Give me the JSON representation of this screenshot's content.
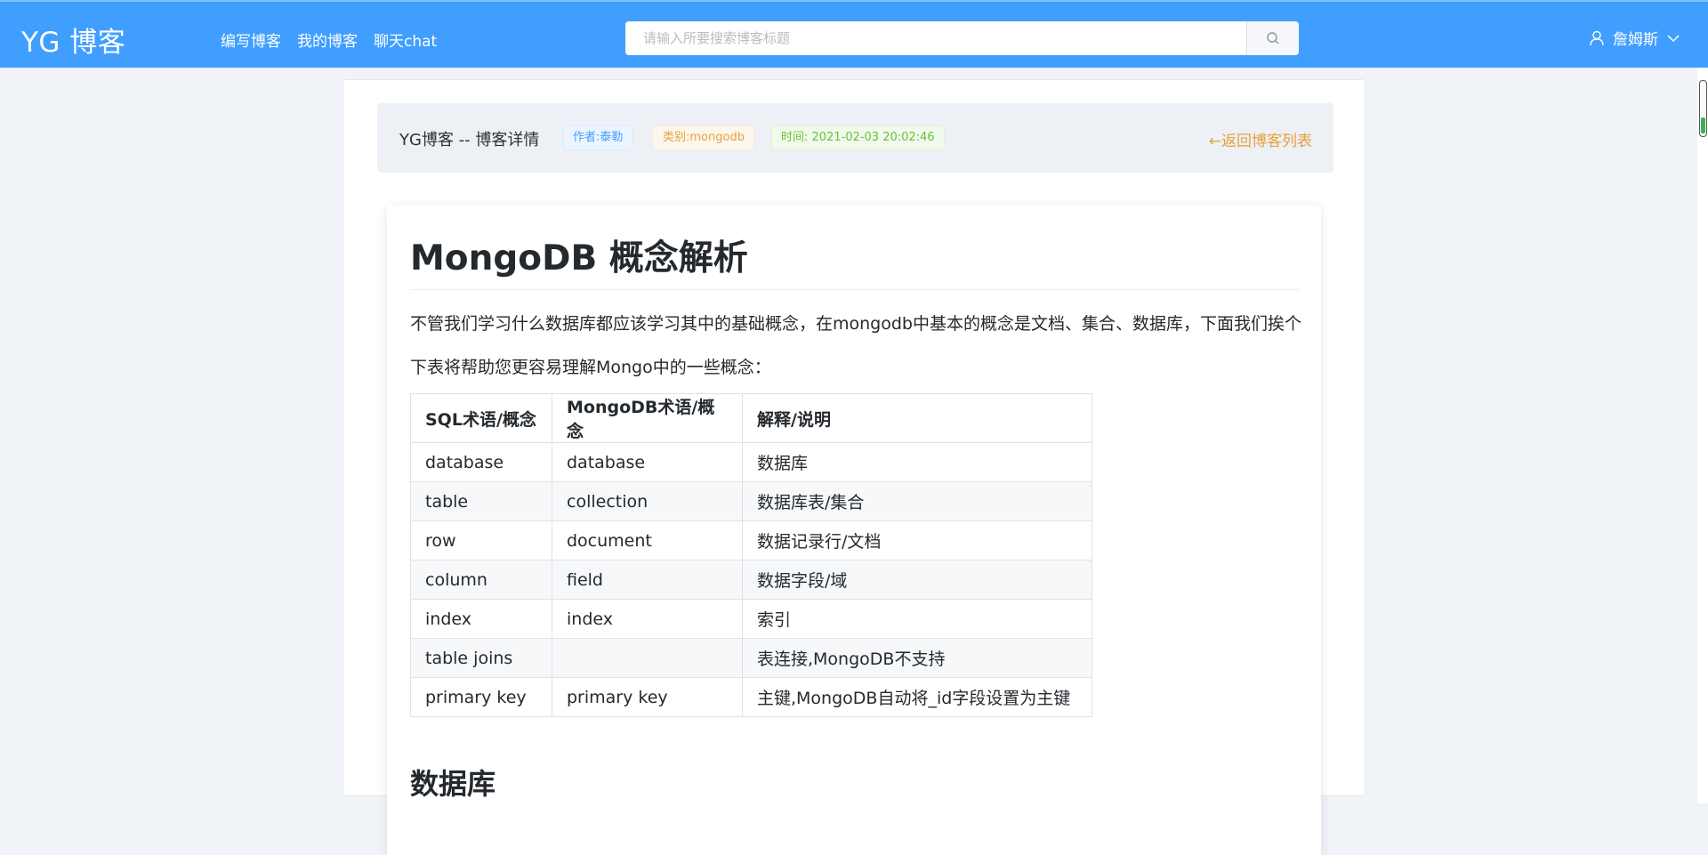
{
  "navbar": {
    "logo": "YG 博客",
    "links": [
      "编写博客",
      "我的博客",
      "聊天chat"
    ],
    "search_placeholder": "请输入所要搜索博客标题",
    "user_name": "詹姆斯"
  },
  "page_header": {
    "title": "YG博客 -- 博客详情",
    "author_tag": "作者:泰勒",
    "category_tag": "类别:mongodb",
    "time_tag": "时间: 2021-02-03 20:02:46",
    "back_link": "←返回博客列表"
  },
  "article": {
    "title": "MongoDB 概念解析",
    "para1": "不管我们学习什么数据库都应该学习其中的基础概念，在mongodb中基本的概念是文档、集合、数据库，下面我们挨个",
    "para2": "下表将帮助您更容易理解Mongo中的一些概念：",
    "table_headers": [
      "SQL术语/概念",
      "MongoDB术语/概念",
      "解释/说明"
    ],
    "table_rows": [
      [
        "database",
        "database",
        "数据库"
      ],
      [
        "table",
        "collection",
        "数据库表/集合"
      ],
      [
        "row",
        "document",
        "数据记录行/文档"
      ],
      [
        "column",
        "field",
        "数据字段/域"
      ],
      [
        "index",
        "index",
        "索引"
      ],
      [
        "table joins",
        "",
        "表连接,MongoDB不支持"
      ],
      [
        "primary key",
        "primary key",
        "主键,MongoDB自动将_id字段设置为主键"
      ]
    ],
    "next_heading": "数据库"
  }
}
